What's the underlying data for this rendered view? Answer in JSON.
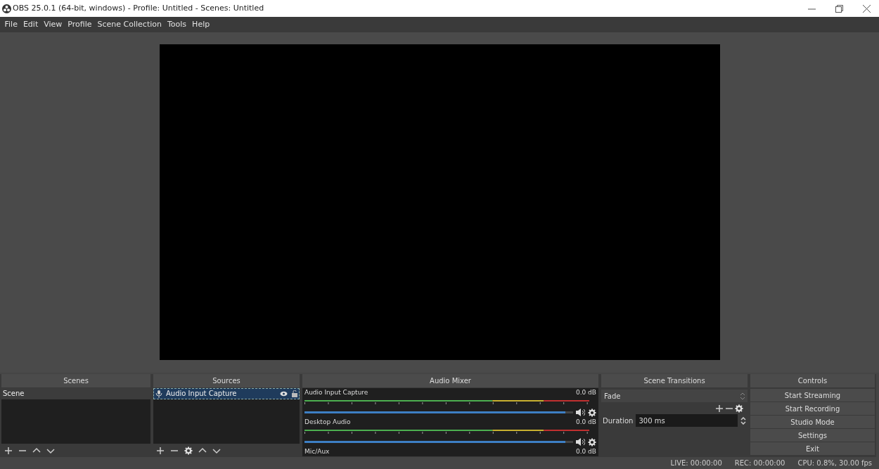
{
  "window": {
    "title": "OBS 25.0.1 (64-bit, windows) - Profile: Untitled - Scenes: Untitled"
  },
  "menu": [
    "File",
    "Edit",
    "View",
    "Profile",
    "Scene Collection",
    "Tools",
    "Help"
  ],
  "scenes": {
    "title": "Scenes",
    "items": [
      {
        "label": "Scene",
        "selected": true
      }
    ]
  },
  "sources": {
    "title": "Sources",
    "items": [
      {
        "label": "Audio Input Capture",
        "selected": true,
        "visible": true,
        "locked": false
      }
    ]
  },
  "audio_mixer": {
    "title": "Audio Mixer",
    "channels": [
      {
        "name": "Audio Input Capture",
        "reading": "0.0 dB",
        "level": 0.97
      },
      {
        "name": "Desktop Audio",
        "reading": "0.0 dB",
        "level": 0.97
      },
      {
        "name": "Mic/Aux",
        "reading": "0.0 dB"
      }
    ]
  },
  "scene_transitions": {
    "title": "Scene Transitions",
    "transition": "Fade",
    "duration_label": "Duration",
    "duration": "300 ms"
  },
  "controls": {
    "title": "Controls",
    "buttons": [
      "Start Streaming",
      "Start Recording",
      "Studio Mode",
      "Settings",
      "Exit"
    ]
  },
  "status_bar": [
    "LIVE: 00:00:00",
    "REC: 00:00:00",
    "CPU: 0.8%, 30.00 fps"
  ]
}
